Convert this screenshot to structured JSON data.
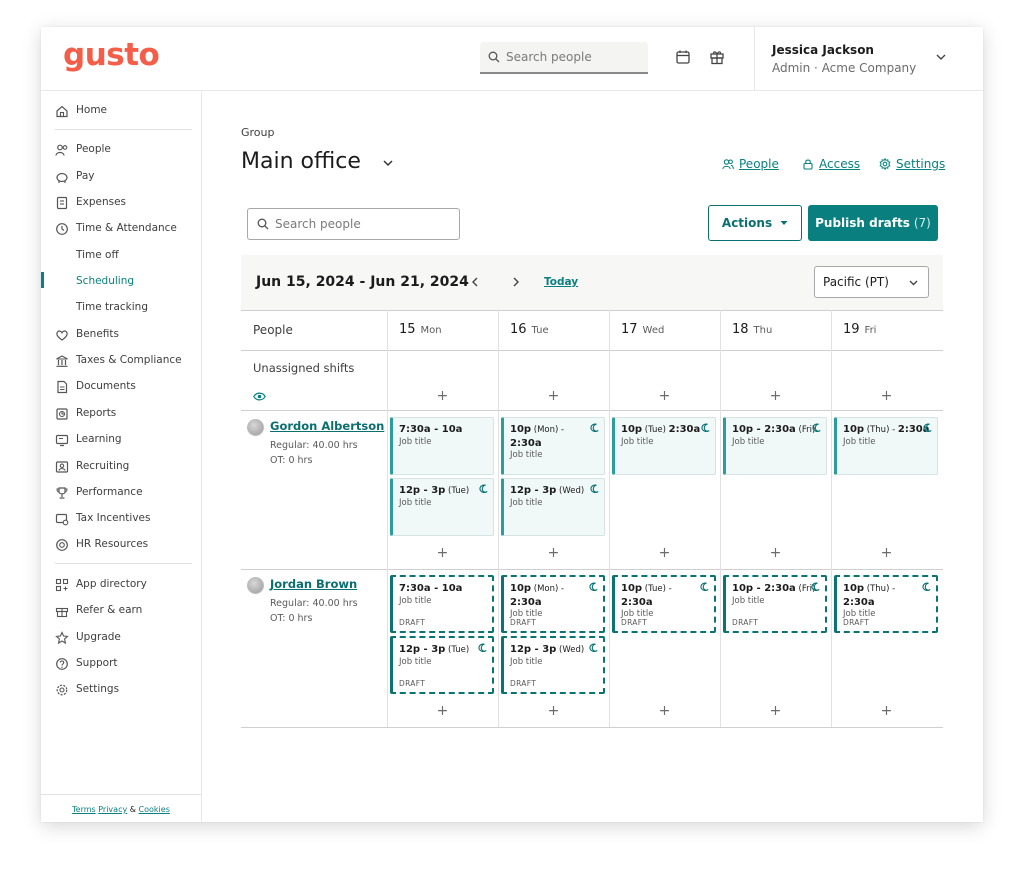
{
  "brand": {
    "logo": "gusto",
    "accent": "#f45d48",
    "teal": "#0a7f7f"
  },
  "topbar": {
    "search_placeholder": "Search people",
    "user_name": "Jessica Jackson",
    "user_sub": "Admin · Acme Company"
  },
  "sidebar": {
    "items": [
      {
        "label": "Home",
        "icon": "home-icon"
      },
      {
        "label": "People",
        "icon": "people-icon"
      },
      {
        "label": "Pay",
        "icon": "piggy-bank-icon"
      },
      {
        "label": "Expenses",
        "icon": "receipt-icon"
      },
      {
        "label": "Time & Attendance",
        "icon": "clock-icon"
      },
      {
        "label": "Time off",
        "icon": ""
      },
      {
        "label": "Scheduling",
        "icon": "",
        "active": true
      },
      {
        "label": "Time tracking",
        "icon": ""
      },
      {
        "label": "Benefits",
        "icon": "heart-icon"
      },
      {
        "label": "Taxes & Compliance",
        "icon": "bank-icon"
      },
      {
        "label": "Documents",
        "icon": "document-icon"
      },
      {
        "label": "Reports",
        "icon": "report-icon"
      },
      {
        "label": "Learning",
        "icon": "learning-icon"
      },
      {
        "label": "Recruiting",
        "icon": "recruiting-icon"
      },
      {
        "label": "Performance",
        "icon": "trophy-icon"
      },
      {
        "label": "Tax Incentives",
        "icon": "tax-incentive-icon"
      },
      {
        "label": "HR Resources",
        "icon": "lifebuoy-icon"
      },
      {
        "label": "App directory",
        "icon": "apps-icon"
      },
      {
        "label": "Refer & earn",
        "icon": "gift-icon"
      },
      {
        "label": "Upgrade",
        "icon": "star-icon"
      },
      {
        "label": "Support",
        "icon": "help-icon"
      },
      {
        "label": "Settings",
        "icon": "gear-icon"
      }
    ],
    "footer": {
      "terms": "Terms",
      "privacy": "Privacy",
      "amp": "&",
      "cookies": "Cookies"
    }
  },
  "main": {
    "group_label": "Group",
    "title": "Main office",
    "links": {
      "people": "People",
      "access": "Access",
      "settings": "Settings"
    },
    "search_placeholder": "Search people",
    "actions_label": "Actions",
    "publish_label": "Publish drafts",
    "publish_count": "(7)"
  },
  "schedule": {
    "date_range": "Jun 15, 2024 - Jun 21, 2024",
    "today": "Today",
    "timezone": "Pacific (PT)",
    "people_header": "People",
    "unassigned": "Unassigned shifts",
    "days": [
      {
        "num": "15",
        "name": "Mon"
      },
      {
        "num": "16",
        "name": "Tue"
      },
      {
        "num": "17",
        "name": "Wed"
      },
      {
        "num": "18",
        "name": "Thu"
      },
      {
        "num": "19",
        "name": "Fri"
      }
    ],
    "people": [
      {
        "name": "Gordon Albertson",
        "regular": "Regular: 40.00 hrs",
        "ot": "OT: 0 hrs",
        "shifts": [
          {
            "day": 0,
            "slot": 0,
            "time": "7:30a - 10a",
            "suffix": "",
            "job": "Job title",
            "night": false,
            "draft": false
          },
          {
            "day": 1,
            "slot": 0,
            "time": "10p",
            "suffix": " (Mon) -",
            "time2": "2:30a",
            "job": "Job title",
            "night": true,
            "draft": false
          },
          {
            "day": 2,
            "slot": 0,
            "time": "10p",
            "suffix": " (Tue) ",
            "time2": "2:30a",
            "inline": true,
            "job": "Job title",
            "night": true,
            "draft": false
          },
          {
            "day": 3,
            "slot": 0,
            "time": "10p - 2:30a",
            "suffix": " (Fri)",
            "job": "Job title",
            "night": true,
            "draft": false
          },
          {
            "day": 4,
            "slot": 0,
            "time": "10p",
            "suffix": " (Thu) - ",
            "time2": "2:30a",
            "inline": true,
            "job": "Job title",
            "night": true,
            "draft": false
          },
          {
            "day": 0,
            "slot": 1,
            "time": "12p - 3p",
            "suffix": " (Tue)",
            "job": "Job title",
            "night": true,
            "draft": false
          },
          {
            "day": 1,
            "slot": 1,
            "time": "12p - 3p",
            "suffix": " (Wed)",
            "job": "Job title",
            "night": true,
            "draft": false
          }
        ]
      },
      {
        "name": "Jordan Brown",
        "regular": "Regular: 40.00 hrs",
        "ot": "OT: 0 hrs",
        "shifts": [
          {
            "day": 0,
            "slot": 0,
            "time": "7:30a - 10a",
            "suffix": "",
            "job": "Job title",
            "night": false,
            "draft": true
          },
          {
            "day": 1,
            "slot": 0,
            "time": "10p",
            "suffix": " (Mon) -",
            "time2": "2:30a",
            "job": "Job title",
            "night": true,
            "draft": true
          },
          {
            "day": 2,
            "slot": 0,
            "time": "10p",
            "suffix": " (Tue) -",
            "time2": "2:30a",
            "job": "Job title",
            "night": true,
            "draft": true
          },
          {
            "day": 3,
            "slot": 0,
            "time": "10p - 2:30a",
            "suffix": " (Fri)",
            "job": "Job title",
            "night": true,
            "draft": true
          },
          {
            "day": 4,
            "slot": 0,
            "time": "10p",
            "suffix": " (Thu) -",
            "time2": "2:30a",
            "job": "Job title",
            "night": true,
            "draft": true
          },
          {
            "day": 0,
            "slot": 1,
            "time": "12p - 3p",
            "suffix": " (Tue)",
            "job": "Job title",
            "night": true,
            "draft": true
          },
          {
            "day": 1,
            "slot": 1,
            "time": "12p - 3p",
            "suffix": " (Wed)",
            "job": "Job title",
            "night": true,
            "draft": true
          }
        ],
        "draft_label": "DRAFT"
      }
    ]
  }
}
